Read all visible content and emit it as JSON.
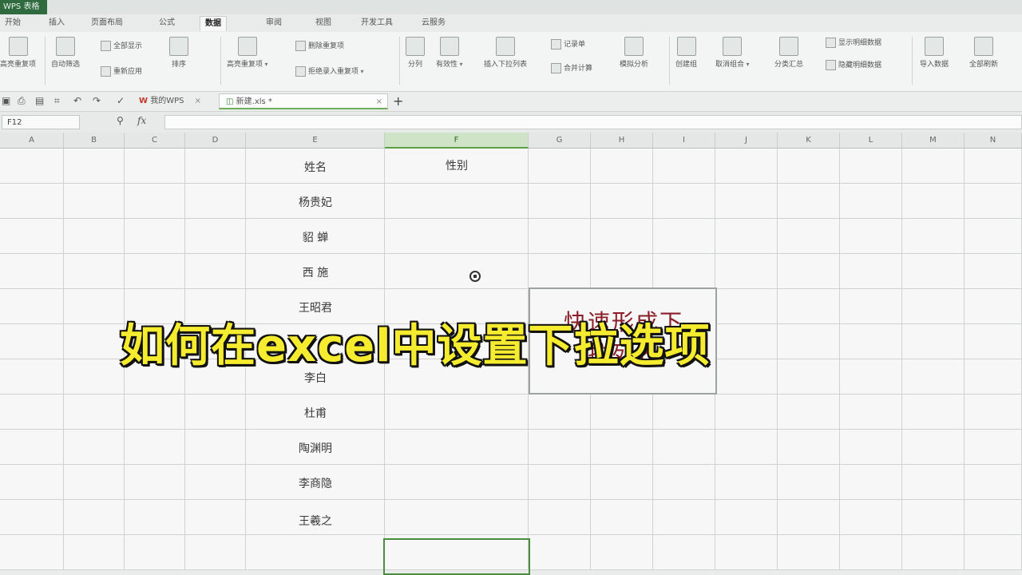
{
  "app": {
    "title": "WPS 表格"
  },
  "menu": {
    "tabs": [
      "开始",
      "插入",
      "页面布局",
      "公式",
      "数据",
      "审阅",
      "视图",
      "开发工具",
      "云服务"
    ],
    "active_index": 4
  },
  "ribbon": {
    "group1": {
      "filter_label": "自动筛选",
      "show_all": "全部显示",
      "reapply": "重新应用",
      "sort_label": "排序",
      "left_label": "高亮重复项"
    },
    "group2": {
      "dup_label": "高亮重复项",
      "delete_dup": "删除重复项",
      "reject_dup": "拒绝录入重复项"
    },
    "group3": {
      "split_label": "分列",
      "validity_label": "有效性",
      "dropdown_label": "插入下拉列表",
      "record_label": "记录单",
      "merge_calc": "合并计算",
      "simulate_label": "模拟分析"
    },
    "group4": {
      "create_group": "创建组",
      "ungroup": "取消组合",
      "subtotal": "分类汇总",
      "show_detail": "显示明细数据",
      "hide_detail": "隐藏明细数据"
    },
    "group5": {
      "import_label": "导入数据",
      "refresh_label": "全部刷新"
    }
  },
  "tabs": {
    "my_wps": "我的WPS",
    "file_tab": "新建.xls *"
  },
  "formula_bar": {
    "cell_ref": "F12",
    "fx": "fx",
    "value": ""
  },
  "columns": [
    "A",
    "B",
    "C",
    "D",
    "E",
    "F",
    "G",
    "H",
    "I",
    "J",
    "K",
    "L",
    "M",
    "N"
  ],
  "selected_column": "F",
  "sheet": {
    "header_name": "姓名",
    "header_gender": "性别",
    "names": [
      "杨贵妃",
      "貂 蝉",
      "西 施",
      "王昭君",
      "",
      "李白",
      "杜甫",
      "陶渊明",
      "李商隐",
      "王羲之"
    ]
  },
  "popup": {
    "line1": "快速形成下",
    "line2": "拉列表"
  },
  "caption": {
    "text": "如何在excel中设置下拉选项"
  },
  "colors": {
    "caption": "#f6ec2f",
    "popup_text": "#8a1f2a",
    "selection": "#4b8d3e"
  }
}
